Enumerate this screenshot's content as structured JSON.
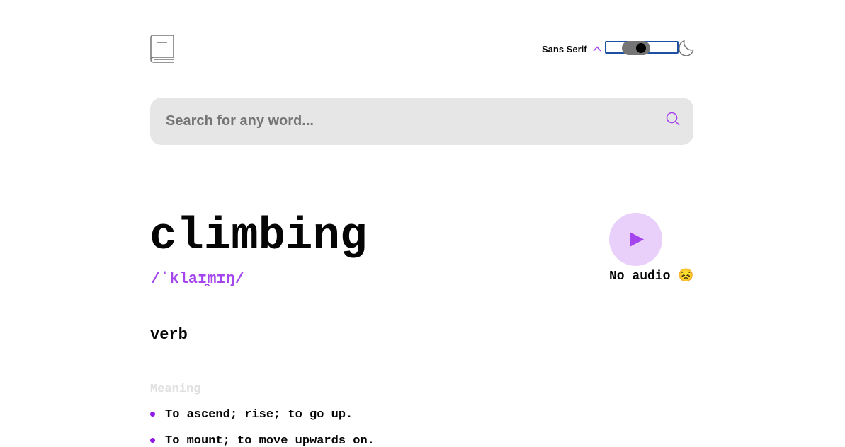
{
  "header": {
    "logo_icon": "book-icon",
    "font_selector": {
      "selected": "Sans Serif",
      "icon": "chevron-up-icon"
    },
    "theme_toggle": {
      "state": "on",
      "icon": "moon-icon"
    }
  },
  "search": {
    "placeholder": "Search for any word...",
    "value": "",
    "icon": "search-icon"
  },
  "entry": {
    "word": "climbing",
    "phonetic": "/ˈklaɪ̯mɪŋ/",
    "play_icon": "play-icon",
    "audio_status": "No audio 😣"
  },
  "meanings": [
    {
      "part_of_speech": "verb",
      "heading": "Meaning",
      "definitions": [
        "To ascend; rise; to go up.",
        "To mount; to move upwards on."
      ]
    }
  ],
  "colors": {
    "accent": "#a445ed",
    "play_bg": "#e9d0fa",
    "search_bg": "#e6e6e6",
    "toggle_track": "#757575",
    "focus_outline": "#1d4fa3"
  }
}
